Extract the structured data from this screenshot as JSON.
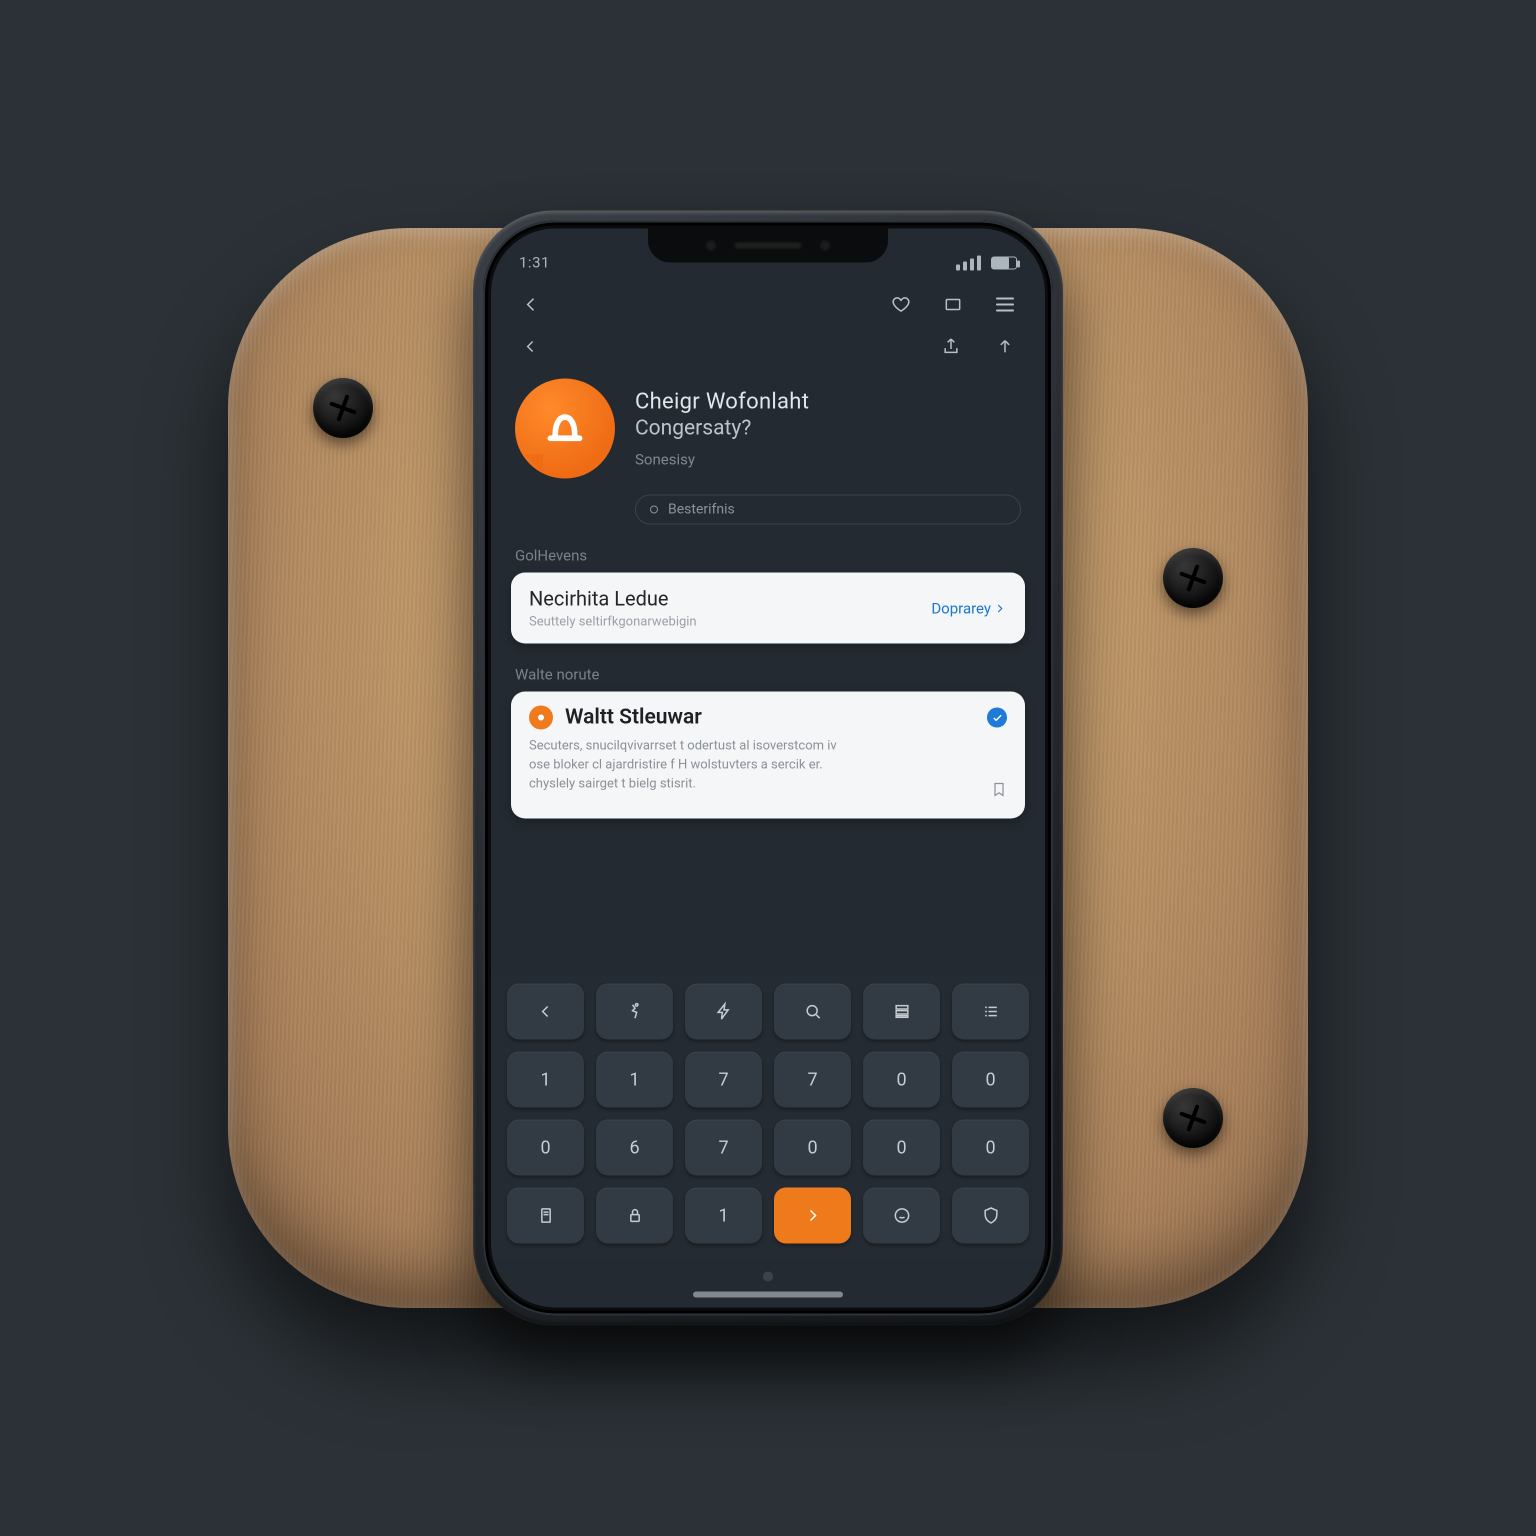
{
  "statusbar": {
    "time": "1:31"
  },
  "profile": {
    "title_line1": "Cheigr Wofonlaht",
    "title_line2": "Congersaty?",
    "meta": "Sonesisy",
    "chip": "Besterifnis"
  },
  "sections": {
    "grievens": "GolHevens",
    "walnorute": "Walte norute"
  },
  "card1": {
    "title": "Necirhita Ledue",
    "subtitle": "Seuttely seltirfkgonarwebigin",
    "action": "Doprarey"
  },
  "card2": {
    "title": "Waltt Stleuwar",
    "body_l1": "Secuters, snucilqvivarrset t odertust al isoverstcom iv",
    "body_l2": "ose bloker cl ajardristire f H wolstuvters a sercik er.",
    "body_l3": "chyslely sairget t bielg stisrit."
  },
  "keys": {
    "r1": [
      "back",
      "run",
      "bolt",
      "search",
      "stack",
      "list"
    ],
    "r2": [
      "1",
      "1",
      "7",
      "7",
      "0",
      "0"
    ],
    "r3": [
      "0",
      "6",
      "7",
      "0",
      "0",
      "0"
    ],
    "r4": [
      "doc",
      "lock",
      "1",
      ">",
      "smile",
      "shield"
    ]
  },
  "colors": {
    "accent": "#ef7a1c",
    "link": "#1778d6"
  }
}
